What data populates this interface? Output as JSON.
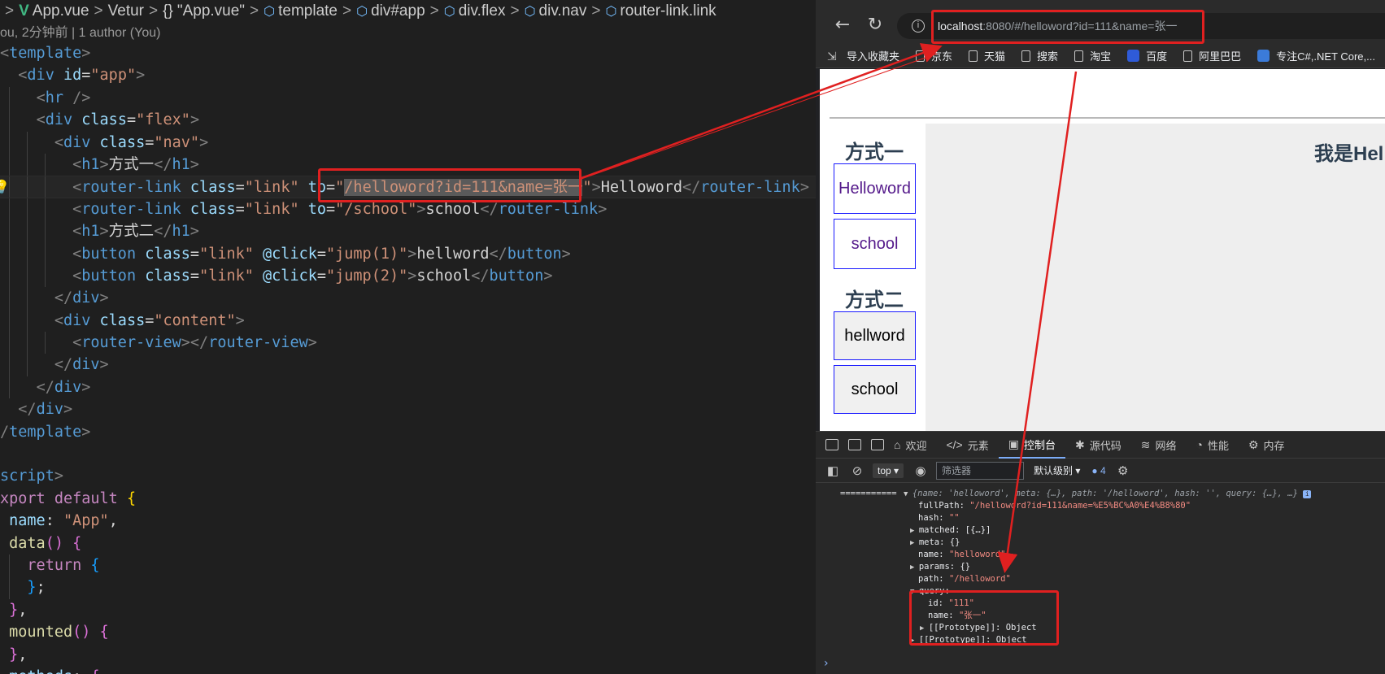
{
  "editor": {
    "breadcrumb": {
      "file": "App.vue",
      "extension": "Vetur",
      "scope": "\"App.vue\"",
      "items": [
        "template",
        "div#app",
        "div.flex",
        "div.nav",
        "router-link.link"
      ]
    },
    "blame": "ou, 2分钟前 | 1 author (You)",
    "code": {
      "tpl_open": "template",
      "div": "div",
      "id_attr": "id",
      "app_str": "\"app\"",
      "hr": "hr",
      "class_attr": "class",
      "flex_str": "\"flex\"",
      "nav_str": "\"nav\"",
      "h1": "h1",
      "method1": "方式一",
      "router_link": "router-link",
      "link_str": "\"link\"",
      "to_attr": "to",
      "to_helloword_value": "/helloword?id=111&name=张一",
      "helloword_text": "Helloword",
      "school_path": "\"/school\"",
      "school_text": "school",
      "method2": "方式二",
      "button": "button",
      "click_attr": "@click",
      "jump1": "\"jump(1)\"",
      "jump2": "\"jump(2)\"",
      "hellword_text": "hellword",
      "content_str": "\"content\"",
      "router_view": "router-view",
      "script": "script",
      "export_default": "xport default",
      "name_key": "name",
      "name_value": "\"App\"",
      "data_fn": "data",
      "return_kw": "return",
      "mounted_fn": "mounted",
      "methods_fn": "methods"
    }
  },
  "browser": {
    "url_host": "localhost",
    "url_rest": ":8080/#/helloword?id=111&name=张一",
    "bookmarks": [
      "导入收藏夹",
      "京东",
      "天猫",
      "搜索",
      "淘宝",
      "百度",
      "阿里巴巴",
      "专注C#,.NET Core,..."
    ],
    "page": {
      "heading1": "方式一",
      "link1": "Helloword",
      "link2": "school",
      "heading2": "方式二",
      "button1": "hellword",
      "button2": "school",
      "content_heading": "我是Hell"
    }
  },
  "devtools": {
    "tabs": [
      "欢迎",
      "元素",
      "控制台",
      "源代码",
      "网络",
      "性能",
      "内存"
    ],
    "active_tab": "控制台",
    "context": "top",
    "filter_placeholder": "筛选器",
    "level": "默认级别",
    "message_count": "4",
    "console": {
      "separator": "===========",
      "summary": "{name: 'helloword', meta: {…}, path: '/helloword', hash: '', query: {…}, …}",
      "fullpath_key": "fullPath:",
      "fullpath_val": "\"/helloword?id=111&name=%E5%BC%A0%E4%B8%80\"",
      "hash_key": "hash:",
      "hash_val": "\"\"",
      "matched_key": "matched:",
      "matched_val": "[{…}]",
      "meta_key": "meta:",
      "meta_val": "{}",
      "name_key": "name:",
      "name_val": "\"helloword\"",
      "params_key": "params:",
      "params_val": "{}",
      "path_key": "path:",
      "path_val": "\"/helloword\"",
      "query_key": "query:",
      "id_key": "id:",
      "id_val": "\"111\"",
      "qname_key": "name:",
      "qname_val": "\"张一\"",
      "proto_key": "[[Prototype]]:",
      "proto_val": "Object",
      "proto2_key": "[[Prototype]]:",
      "proto2_val": "Object"
    }
  },
  "colors": {
    "annotation_red": "#e02020",
    "vue_green": "#41b883",
    "link_border": "#1a1aff"
  }
}
